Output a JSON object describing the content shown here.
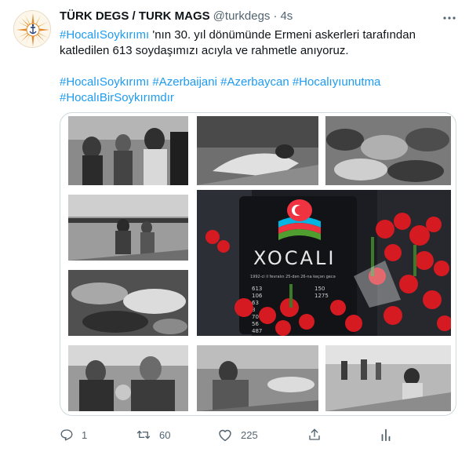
{
  "author": {
    "display_name": "TÜRK DEGS / TURK MAGS",
    "handle": "@turkdegs",
    "separator": "·",
    "time": "4s",
    "avatar_icon": "compass-rose-anchor-logo"
  },
  "tweet": {
    "line1_hashtag": "#HocalıSoykırımı",
    "line1_text": " 'nın 30. yıl dönümünde Ermeni askerleri tarafından",
    "line2_text": "katledilen 613 soydaşımızı acıyla ve rahmetle anıyoruz.",
    "hashtags_line1": [
      " #HocalıSoykırımı",
      "#Azerbaijani",
      "#Azerbaycan",
      "#Hocalıyıunutma"
    ],
    "hashtags_line2": [
      "#HocalıBirSoykırımdır"
    ]
  },
  "media": {
    "memorial_plaque_title": "XOCALI",
    "memorial_subtitle": "1992-ci il fevralın 25-dən 26-na keçən gecə",
    "memorial_numbers_left": [
      "613",
      "106",
      "63",
      "8",
      "70",
      "56",
      "487"
    ],
    "memorial_numbers_right": [
      "150",
      "1275"
    ],
    "flag_colors": {
      "blue": "#00b5e2",
      "red": "#ef3340",
      "green": "#509e2f"
    }
  },
  "actions": {
    "reply_count": "1",
    "retweet_count": "60",
    "like_count": "225",
    "icons": [
      "reply-icon",
      "retweet-icon",
      "like-icon",
      "share-icon",
      "analytics-icon"
    ]
  },
  "colors": {
    "link": "#1d9bf0",
    "secondary_text": "#536471",
    "primary_text": "#0f1419",
    "border": "#cfd9de"
  }
}
